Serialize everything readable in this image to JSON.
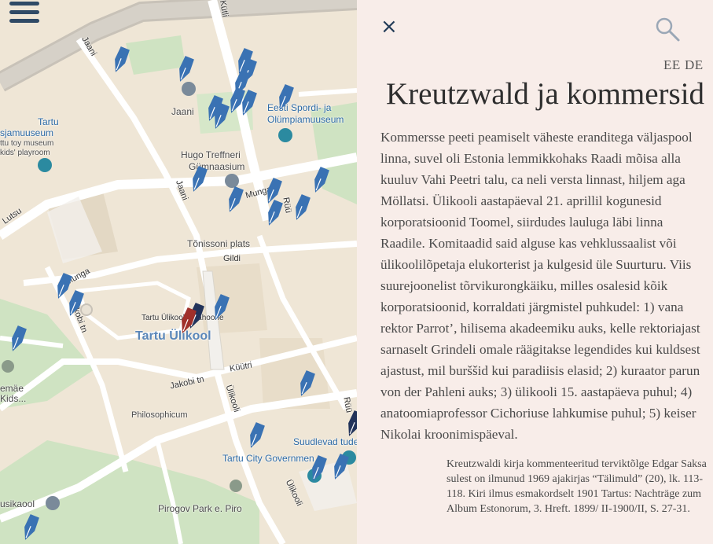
{
  "map": {
    "menu_icon": "hamburger-icon",
    "labels": {
      "jaani1": "Jaani",
      "jaani2": "Jaani",
      "jaani3": "Jaani",
      "lutsu": "Lutsu",
      "munga1": "Munga",
      "munga2": "Munga",
      "gildi": "Gildi",
      "tonissoni": "Tõnissoni plats",
      "kuutri": "Küütri",
      "ulikooli": "Ülikooli",
      "ulikooli2": "Ülikooli",
      "jakobi1": "Jakobi tn",
      "jakobi2": "Jakobi tn",
      "ruutli": "Rüü",
      "ruutli2": "Rüü",
      "kutli": "Kütli",
      "spordi": "Eesti Spordi- ja",
      "spordi2": "Olümpiamuuseum",
      "toy1": "Tartu",
      "toy2": "sjamuuseum",
      "toy3": "ttu toy museum",
      "toy4": "kids' playroom",
      "hugo1": "Hugo Treffneri",
      "hugo2": "Gümnaasium",
      "ulikool_big": "Tartu Ülikool",
      "ulikool_small": "Tartu Ülikooli peahoone",
      "philo": "Philosophicum",
      "suud": "Suudlevad tudeng",
      "city_gov": "Tartu City Governmen",
      "pirogov": "Pirogov Park e. Piro",
      "musi": "usikaool",
      "emae1": "emäe",
      "emae2": "Kids..."
    }
  },
  "panel": {
    "close_label": "×",
    "lang_ee": "EE",
    "lang_de": "DE",
    "title": "Kreutzwald ja kommersid",
    "body": "Kommersse peeti peamiselt väheste eranditega väljaspool linna, suvel oli Estonia lemmikkohaks Raadi mõisa alla kuuluv Vahi Peetri talu, ca neli versta linnast, hiljem aga Möllatsi. Ülikooli aastapäeval 21. aprillil kogunesid korporatsioonid Toomel, siirdudes lauluga läbi linna Raadile. Komitaadid said alguse kas vehklussaalist või ülikoolilõpetaja elukorterist ja kulgesid üle Suurturu. Viis suurejoonelist tõrvikurongkäiku, milles osalesid kõik korporatsioonid, korraldati järgmistel puhkudel:  1) vana rektor Parrot’, hilisema akadeemiku auks, kelle rektoriajast sarnaselt Grindeli omale räägitakse legendides kui kuldsest ajastust, mil burššid kui paradiisis elasid;  2) kuraator parun von der Pahleni auks; 3) ülikooli 15. aastapäeva puhul; 4) anatoomiaprofessor Cichoriuse lahkumise puhul; 5) keiser Nikolai kroonimispäeval.",
    "note": "Kreutzwaldi kirja kommenteeritud terviktõlge Edgar Saksa sulest on ilmunud 1969 ajakirjas “Tälimuld” (20), lk. 113-118. Kiri ilmus esmakordselt 1901 Tartus: Nachträge zum Album Estonorum, 3. Hreft. 1899/ II-1900/II, S. 27-31."
  }
}
